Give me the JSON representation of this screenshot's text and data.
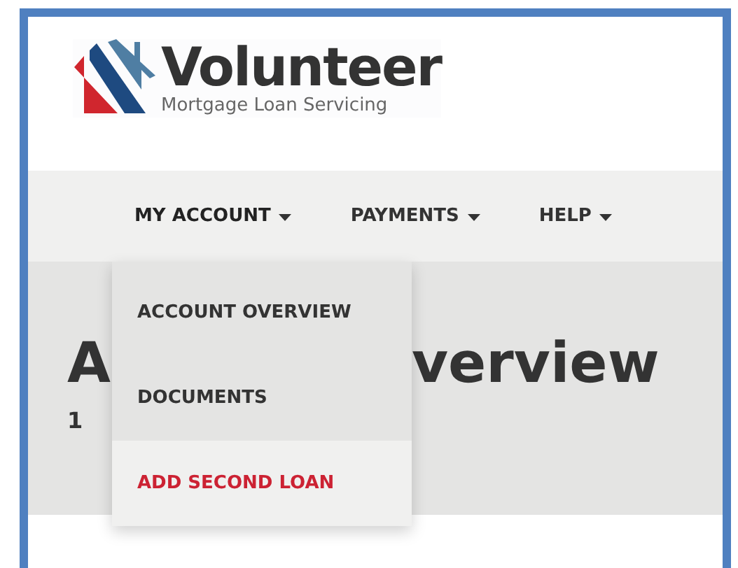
{
  "logo": {
    "name": "Volunteer",
    "tagline": "Mortgage Loan Servicing"
  },
  "nav": [
    {
      "label": "MY ACCOUNT",
      "expanded": true
    },
    {
      "label": "PAYMENTS",
      "expanded": false
    },
    {
      "label": "HELP",
      "expanded": false
    }
  ],
  "dropdown": [
    {
      "label": "ACCOUNT OVERVIEW",
      "selected": false
    },
    {
      "label": "DOCUMENTS",
      "selected": false
    },
    {
      "label": "ADD SECOND LOAN",
      "selected": true
    }
  ],
  "hero": {
    "title_left": "A",
    "title_right": "verview",
    "subtitle": "1"
  }
}
